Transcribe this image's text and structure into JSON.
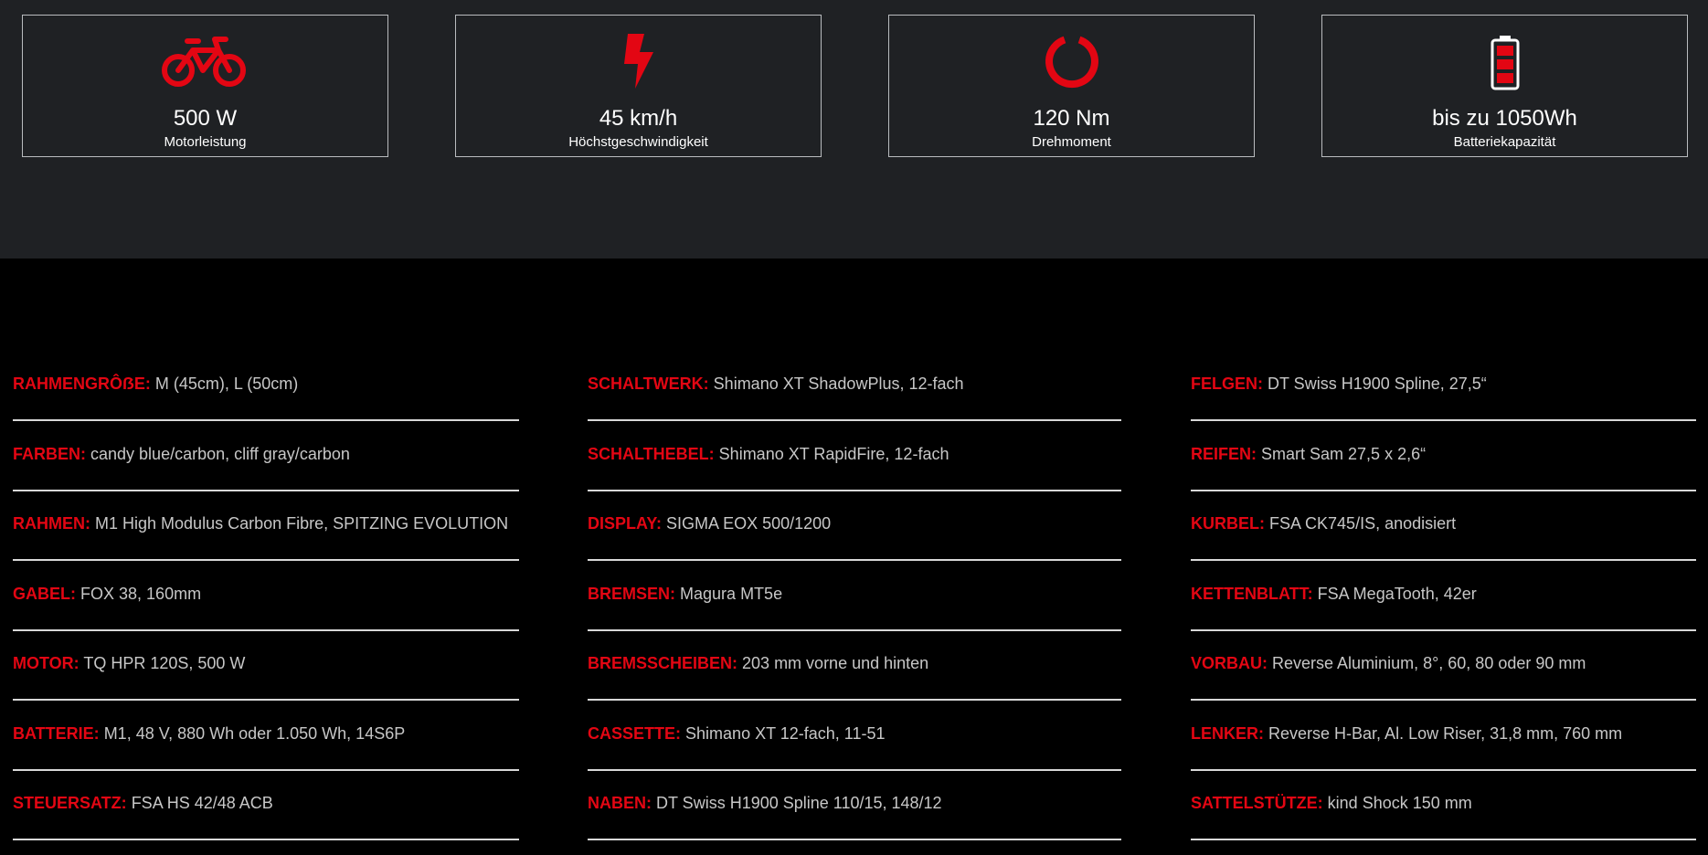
{
  "colors": {
    "accent": "#e30613",
    "top_bg": "#1f2124",
    "bottom_bg": "#000000"
  },
  "stats": [
    {
      "icon": "bicycle-icon",
      "value": "500 W",
      "label": "Motorleistung"
    },
    {
      "icon": "lightning-bolt-icon",
      "value": "45 km/h",
      "label": "Höchstgeschwindigkeit"
    },
    {
      "icon": "ring-icon",
      "value": "120 Nm",
      "label": "Drehmoment"
    },
    {
      "icon": "battery-icon",
      "value": "bis zu 1050Wh",
      "label": "Batteriekapazität"
    }
  ],
  "specs": {
    "col1": [
      {
        "key": "RAHMENGRÔẞE:",
        "value": "M (45cm), L (50cm)"
      },
      {
        "key": "FARBEN:",
        "value": "candy blue/carbon, cliff gray/carbon"
      },
      {
        "key": "RAHMEN:",
        "value": "M1 High Modulus Carbon Fibre, SPITZING EVOLUTION"
      },
      {
        "key": "GABEL:",
        "value": "FOX 38, 160mm"
      },
      {
        "key": "MOTOR:",
        "value": "TQ HPR 120S, 500 W"
      },
      {
        "key": "BATTERIE:",
        "value": "M1, 48 V, 880 Wh oder 1.050 Wh, 14S6P"
      },
      {
        "key": "STEUERSATZ:",
        "value": "FSA HS 42/48 ACB"
      }
    ],
    "col2": [
      {
        "key": "SCHALTWERK:",
        "value": "Shimano XT ShadowPlus, 12-fach"
      },
      {
        "key": "SCHALTHEBEL:",
        "value": "Shimano XT RapidFire, 12-fach"
      },
      {
        "key": "DISPLAY:",
        "value": "SIGMA EOX 500/1200"
      },
      {
        "key": "BREMSEN:",
        "value": "Magura MT5e"
      },
      {
        "key": "BREMSSCHEIBEN:",
        "value": "203 mm vorne und hinten"
      },
      {
        "key": "CASSETTE:",
        "value": "Shimano XT 12-fach, 11-51"
      },
      {
        "key": "NABEN:",
        "value": "DT Swiss H1900 Spline 110/15, 148/12"
      }
    ],
    "col3": [
      {
        "key": "FELGEN:",
        "value": "DT Swiss H1900 Spline, 27,5“"
      },
      {
        "key": "REIFEN:",
        "value": "Smart Sam 27,5 x 2,6“"
      },
      {
        "key": "KURBEL:",
        "value": "FSA CK745/IS, anodisiert"
      },
      {
        "key": "KETTENBLATT:",
        "value": "FSA MegaTooth, 42er"
      },
      {
        "key": "VORBAU:",
        "value": "Reverse Aluminium, 8°, 60, 80 oder 90 mm"
      },
      {
        "key": "LENKER:",
        "value": "Reverse H-Bar, Al. Low Riser, 31,8 mm, 760 mm"
      },
      {
        "key": "SATTELSTÜTZE:",
        "value": "kind Shock 150 mm"
      }
    ]
  }
}
